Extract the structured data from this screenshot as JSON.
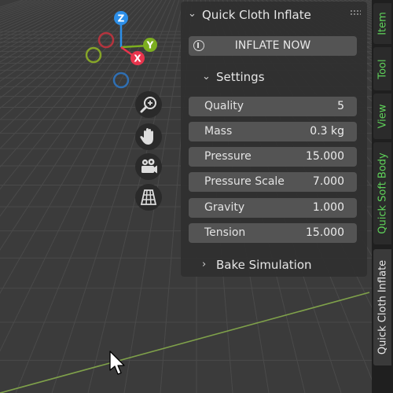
{
  "panel": {
    "title": "Quick Cloth Inflate",
    "inflate_button": "INFLATE NOW",
    "settings_label": "Settings",
    "bake_label": "Bake Simulation",
    "fields": [
      {
        "label": "Quality",
        "value": "5"
      },
      {
        "label": "Mass",
        "value": "0.3 kg"
      },
      {
        "label": "Pressure",
        "value": "15.000"
      },
      {
        "label": "Pressure Scale",
        "value": "7.000"
      },
      {
        "label": "Gravity",
        "value": "1.000"
      },
      {
        "label": "Tension",
        "value": "15.000"
      }
    ]
  },
  "tabs": [
    {
      "label": "Item",
      "active": false
    },
    {
      "label": "Tool",
      "active": false
    },
    {
      "label": "View",
      "active": false
    },
    {
      "label": "Quick Soft Body",
      "active": false
    },
    {
      "label": "Quick Cloth Inflate",
      "active": true
    }
  ],
  "gizmo": {
    "z": "Z",
    "y": "Y",
    "x": "X"
  },
  "colors": {
    "x_axis": "#e8344c",
    "y_axis": "#7cae1f",
    "z_axis": "#2c8fe9",
    "tab_text": "#5fd35a",
    "floor_line": "#7fa14a"
  },
  "icons": [
    "zoom-icon",
    "hand-icon",
    "camera-icon",
    "grid-icon",
    "power-icon"
  ]
}
